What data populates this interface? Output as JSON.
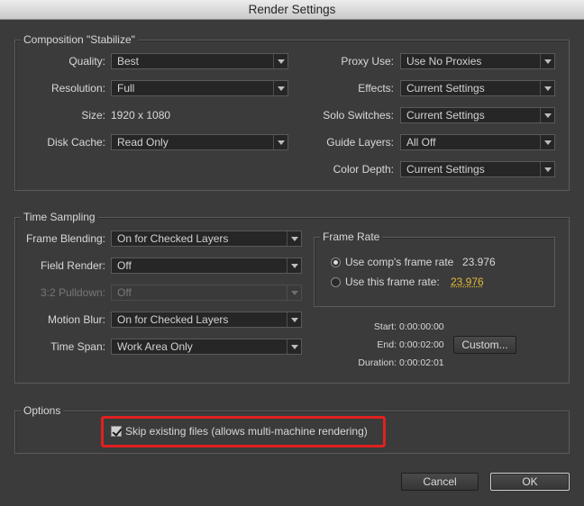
{
  "window": {
    "title": "Render Settings"
  },
  "composition": {
    "title": "Composition \"Stabilize\"",
    "quality": {
      "label": "Quality:",
      "value": "Best"
    },
    "resolution": {
      "label": "Resolution:",
      "value": "Full"
    },
    "size": {
      "label": "Size:",
      "value": "1920 x 1080"
    },
    "disk_cache": {
      "label": "Disk Cache:",
      "value": "Read Only"
    },
    "proxy_use": {
      "label": "Proxy Use:",
      "value": "Use No Proxies"
    },
    "effects": {
      "label": "Effects:",
      "value": "Current Settings"
    },
    "solo_switches": {
      "label": "Solo Switches:",
      "value": "Current Settings"
    },
    "guide_layers": {
      "label": "Guide Layers:",
      "value": "All Off"
    },
    "color_depth": {
      "label": "Color Depth:",
      "value": "Current Settings"
    }
  },
  "time_sampling": {
    "title": "Time Sampling",
    "frame_blending": {
      "label": "Frame Blending:",
      "value": "On for Checked Layers"
    },
    "field_render": {
      "label": "Field Render:",
      "value": "Off"
    },
    "pulldown": {
      "label": "3:2 Pulldown:",
      "value": "Off"
    },
    "motion_blur": {
      "label": "Motion Blur:",
      "value": "On for Checked Layers"
    },
    "time_span": {
      "label": "Time Span:",
      "value": "Work Area Only"
    },
    "frame_rate": {
      "title": "Frame Rate",
      "comp_rate_label": "Use comp's frame rate",
      "comp_rate_value": "23.976",
      "this_rate_label": "Use this frame rate:",
      "this_rate_value": "23.976",
      "selected": "comp"
    },
    "start": {
      "label": "Start:",
      "value": "0:00:00:00"
    },
    "end": {
      "label": "End:",
      "value": "0:00:02:00"
    },
    "duration": {
      "label": "Duration:",
      "value": "0:00:02:01"
    },
    "custom_label": "Custom..."
  },
  "options": {
    "title": "Options",
    "skip_existing": {
      "label": "Skip existing files (allows multi-machine rendering)",
      "checked": true
    }
  },
  "footer": {
    "cancel_label": "Cancel",
    "ok_label": "OK"
  },
  "colors": {
    "highlight": "#e02020",
    "accent_value": "#e5b737"
  }
}
